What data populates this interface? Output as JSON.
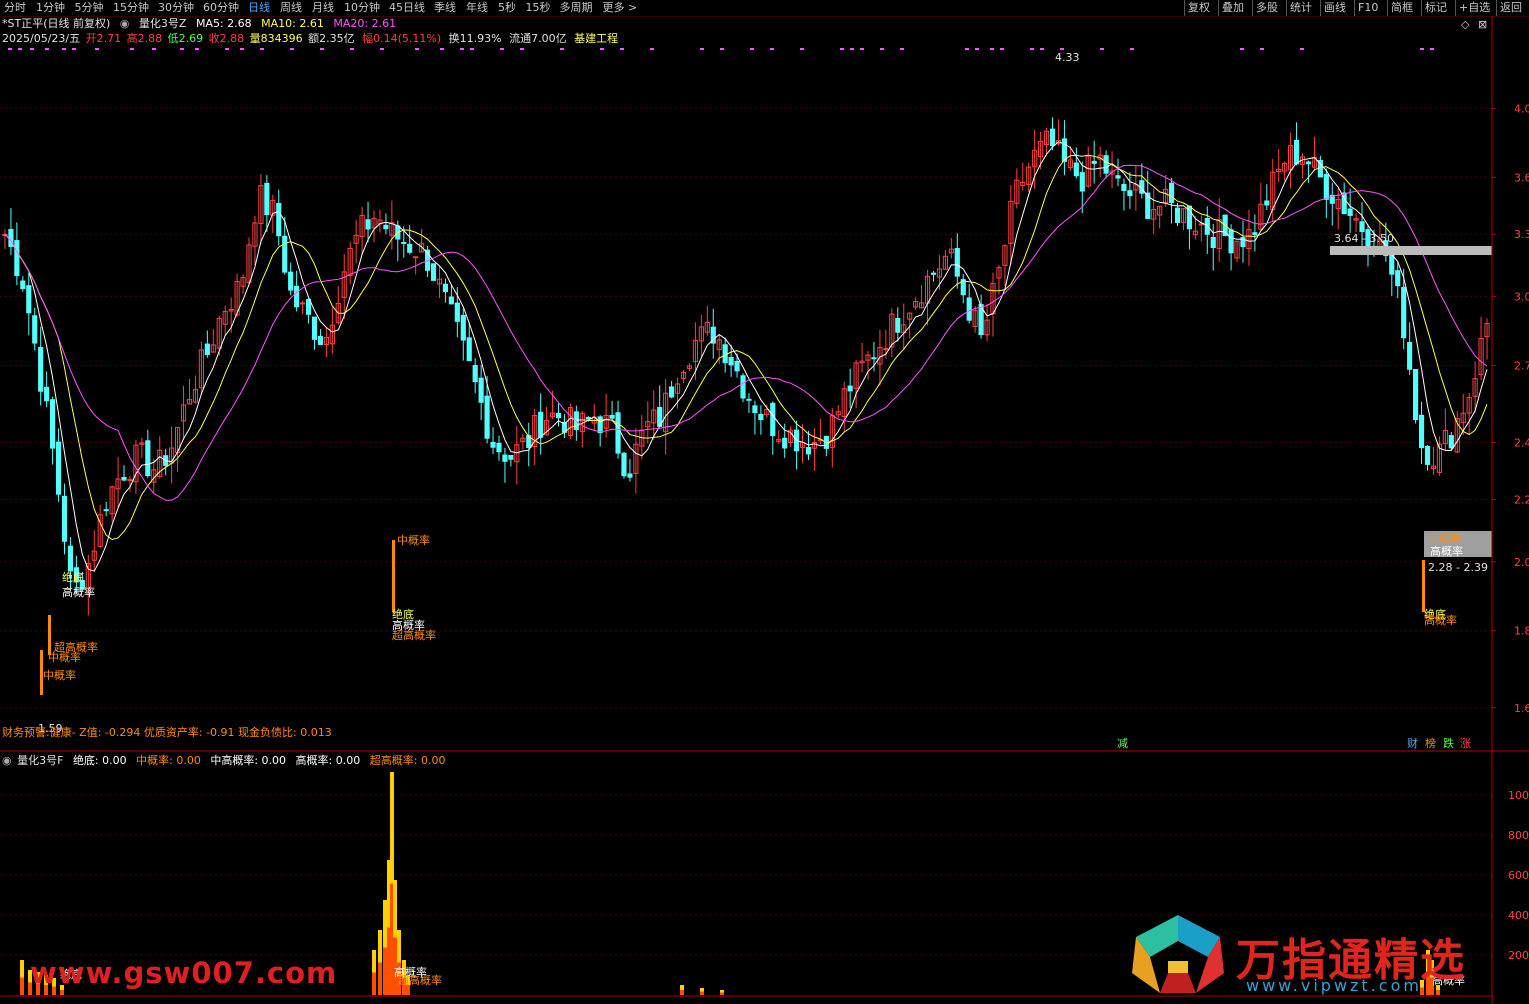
{
  "toolbar": {
    "periods": [
      "分时",
      "1分钟",
      "5分钟",
      "15分钟",
      "30分钟",
      "60分钟",
      "日线",
      "周线",
      "月线",
      "10分钟",
      "45日线",
      "季线",
      "年线",
      "5秒",
      "15秒",
      "多周期",
      "更多 >"
    ],
    "active_period": "日线",
    "right_items": [
      "复权",
      "叠加",
      "多股",
      "统计",
      "画线",
      "F10",
      "简框",
      "标记",
      "+自选",
      "返回"
    ]
  },
  "header": {
    "title": "*ST正平(日线 前复权)",
    "indicator_name": "量化3号Z",
    "ma5": "MA5: 2.68",
    "ma10": "MA10: 2.61",
    "ma20": "MA20: 2.61",
    "date": "2025/05/23/五",
    "open": "开2.71",
    "high": "高2.88",
    "low": "低2.69",
    "close": "收2.88",
    "volume": "量834396",
    "amount": "额2.35亿",
    "change": "幅0.14(5.11%)",
    "turnover": "换11.93%",
    "float_cap": "流通7.00亿",
    "sector": "基建工程"
  },
  "price_axis": [
    "4.0",
    "3.6",
    "3.3",
    "3.0",
    "2.7",
    "2.4",
    "2.2",
    "2.0",
    "1.8",
    "1.6"
  ],
  "price_markers": {
    "high_label": "4.33",
    "low_label": "1.59",
    "zone1": "3.64 - 3.50",
    "zone2": "2.28 - 2.39"
  },
  "signals": {
    "s1": "绝底",
    "s2": "高概率",
    "s3": "超高概率",
    "s4": "中概率",
    "s5": "中概率",
    "s6": "中概率",
    "s7": "绝底",
    "s8": "高概率",
    "s9": "超高概率",
    "s10": "中概率",
    "s11": "高概率",
    "s12": "超高概率",
    "s13": "绝底",
    "s14": "高概率"
  },
  "finance_line": "财务预警:健康- Z值: -0.294 优质资产率: -0.91 现金负债比: 0.013",
  "flags": {
    "jian": "减",
    "cai": "财",
    "bang": "榜",
    "die": "跌",
    "zhang": "涨"
  },
  "sub_header": {
    "name": "量化3号F",
    "juedi": "绝底: 0.00",
    "zhong": "中概率: 0.00",
    "zhonggao": "中高概率: 0.00",
    "gao": "高概率: 0.00",
    "chaogao": "超高概率: 0.00"
  },
  "sub_axis": [
    "100",
    "800",
    "600",
    "400",
    "200"
  ],
  "sub_signals": {
    "a": "绝底",
    "b": "高概率",
    "c": "超高概率",
    "d": "高概率"
  },
  "watermarks": {
    "left": "www.gsw007.com",
    "right": "万指通精选",
    "url": "www.vipwzt.com"
  },
  "colors": {
    "up": "#ff4040",
    "down": "#54ffff",
    "ma5": "#ffffff",
    "ma10": "#ffff54",
    "ma20": "#ff54ff",
    "signal_orange": "#ff8c00",
    "axis": "#b00000"
  },
  "chart_data": {
    "type": "candlestick",
    "x": [
      "2025/05/23"
    ],
    "ylim": [
      1.5,
      4.4
    ],
    "close_series": [
      3.3,
      3.1,
      2.7,
      2.3,
      1.9,
      2.0,
      2.2,
      2.3,
      2.35,
      2.3,
      2.4,
      2.6,
      2.75,
      2.95,
      3.05,
      3.5,
      3.4,
      3.0,
      2.9,
      2.8,
      3.1,
      3.3,
      3.4,
      3.3,
      3.25,
      3.2,
      3.0,
      2.8,
      2.6,
      2.4,
      2.35,
      2.4,
      2.5,
      2.5,
      2.45,
      2.5,
      2.45,
      2.3,
      2.45,
      2.5,
      2.7,
      2.8,
      2.85,
      2.75,
      2.6,
      2.5,
      2.45,
      2.42,
      2.4,
      2.45,
      2.6,
      2.7,
      2.8,
      2.9,
      3.0,
      3.1,
      3.2,
      3.0,
      2.8,
      3.1,
      3.5,
      3.7,
      3.8,
      3.65,
      3.6,
      3.7,
      3.55,
      3.5,
      3.45,
      3.45,
      3.4,
      3.35,
      3.3,
      3.28,
      3.3,
      3.5,
      3.7,
      3.75,
      3.6,
      3.5,
      3.4,
      3.3,
      3.2,
      2.9,
      2.4,
      2.35,
      2.45,
      2.6,
      2.88
    ]
  }
}
